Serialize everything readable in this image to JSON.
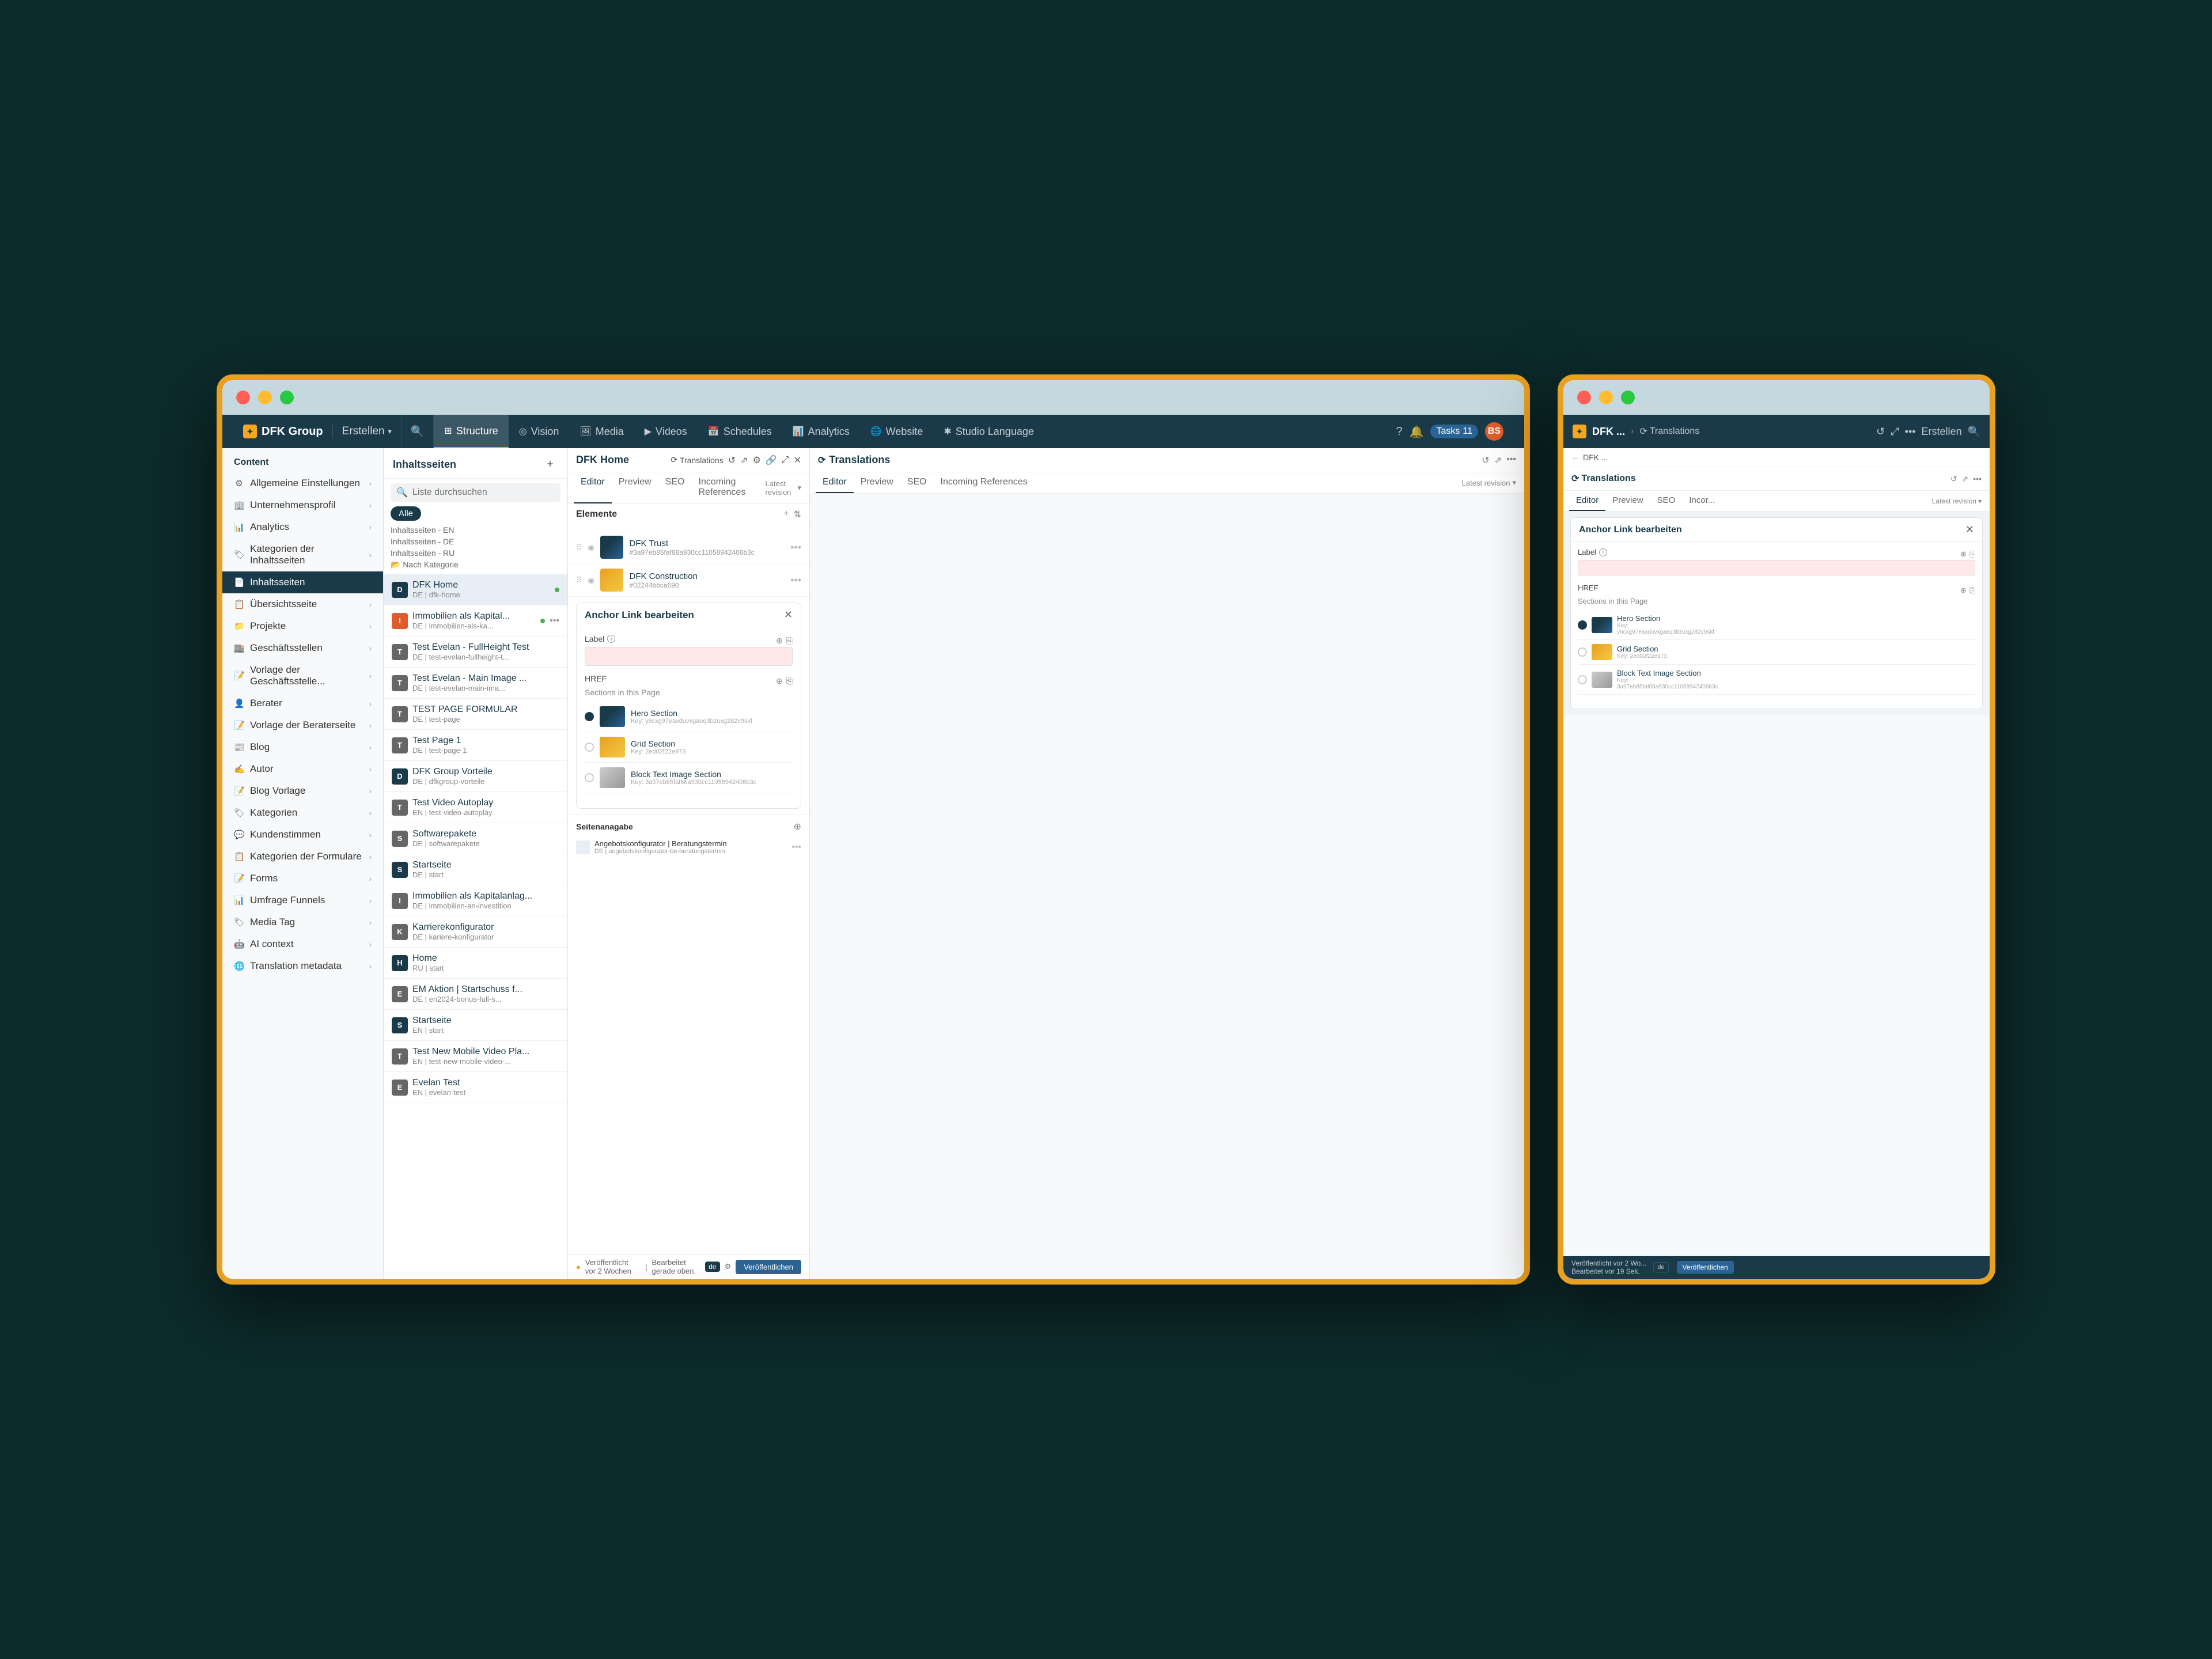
{
  "scene": {
    "background": "#0d2b2b"
  },
  "left_browser": {
    "top_nav": {
      "brand": "DFK Group",
      "brand_icon": "✦",
      "erstellen": "Erstellen",
      "tabs": [
        {
          "label": "Structure",
          "icon": "⊞",
          "active": true
        },
        {
          "label": "Vision",
          "icon": "◎",
          "active": false
        },
        {
          "label": "Media",
          "icon": "🖼",
          "active": false
        },
        {
          "label": "Videos",
          "icon": "▶",
          "active": false
        },
        {
          "label": "Schedules",
          "icon": "📅",
          "active": false
        },
        {
          "label": "Analytics",
          "icon": "📊",
          "active": false
        },
        {
          "label": "Website",
          "icon": "🌐",
          "active": false
        },
        {
          "label": "Studio Language",
          "icon": "✱",
          "active": false
        }
      ],
      "tasks_label": "Tasks",
      "tasks_count": "11",
      "user_initials": "BS"
    },
    "sidebar": {
      "section_title": "Content",
      "items": [
        {
          "label": "Allgemeine Einstellungen",
          "icon": "⚙",
          "active": false
        },
        {
          "label": "Unternehmensprofil",
          "icon": "🏢",
          "active": false
        },
        {
          "label": "Analytics",
          "icon": "📊",
          "active": false
        },
        {
          "label": "Kategorien der Inhaltsseiten",
          "icon": "🏷",
          "active": false
        },
        {
          "label": "Inhaltsseiten",
          "icon": "📄",
          "active": true
        },
        {
          "label": "Übersichtsseite",
          "icon": "📋",
          "active": false
        },
        {
          "label": "Projekte",
          "icon": "📁",
          "active": false
        },
        {
          "label": "Geschäftsstellen",
          "icon": "🏬",
          "active": false
        },
        {
          "label": "Vorlage der Geschäftsstelle...",
          "icon": "📝",
          "active": false
        },
        {
          "label": "Berater",
          "icon": "👤",
          "active": false
        },
        {
          "label": "Vorlage der Beraterseite",
          "icon": "📝",
          "active": false
        },
        {
          "label": "Blog",
          "icon": "📰",
          "active": false
        },
        {
          "label": "Autor",
          "icon": "✍",
          "active": false
        },
        {
          "label": "Blog Vorlage",
          "icon": "📝",
          "active": false
        },
        {
          "label": "Kategorien",
          "icon": "🏷",
          "active": false
        },
        {
          "label": "Kundenstimmen",
          "icon": "💬",
          "active": false
        },
        {
          "label": "Kategorien der Formulare",
          "icon": "📋",
          "active": false
        },
        {
          "label": "Forms",
          "icon": "📝",
          "active": false
        },
        {
          "label": "Umfrage Funnels",
          "icon": "📊",
          "active": false
        },
        {
          "label": "Media Tag",
          "icon": "🏷",
          "active": false
        },
        {
          "label": "AI context",
          "icon": "🤖",
          "active": false
        },
        {
          "label": "Translation metadata",
          "icon": "🌐",
          "active": false
        }
      ]
    },
    "pages_panel": {
      "title": "Inhaltsseiten",
      "search_placeholder": "Liste durchsuchen",
      "filter_tabs": [
        {
          "label": "Alle",
          "active": true
        },
        {
          "label": "Inhaltsseiten - EN",
          "active": false
        },
        {
          "label": "Inhaltsseiten - DE",
          "active": false
        },
        {
          "label": "Inhaltsseiten - RU",
          "active": false
        },
        {
          "label": "Nach Kategorie",
          "active": false
        }
      ],
      "pages": [
        {
          "name": "Immobilien als Kapital...",
          "sub": "DE | immobilien-als-ka...",
          "dot": "green",
          "selected": false
        },
        {
          "name": "Test Evelan - FullHeight Test",
          "sub": "DE | test-evelan-fullheight-t...",
          "dot": "none",
          "selected": false
        },
        {
          "name": "Test Evelan - Main Image ...",
          "sub": "DE | test-evelan-main-ima...",
          "dot": "none",
          "selected": false
        },
        {
          "name": "TEST PAGE FORMULAR",
          "sub": "DE | test-page",
          "dot": "none",
          "selected": false
        },
        {
          "name": "Test Page 1",
          "sub": "DE | test-page-1",
          "dot": "none",
          "selected": false
        },
        {
          "name": "DFK Group Vorteile",
          "sub": "DE | dfkgroup-vorteile",
          "dot": "none",
          "selected": false
        },
        {
          "name": "Test Video Autoplay",
          "sub": "EN | test-video-autoplay",
          "dot": "none",
          "selected": false
        },
        {
          "name": "Softwarepakete",
          "sub": "DE | softwarepakete",
          "dot": "none",
          "selected": false
        },
        {
          "name": "Startseite",
          "sub": "DE | start",
          "dot": "none",
          "selected": false
        },
        {
          "name": "Immobilien als Kapitalanlag...",
          "sub": "DE | immobilien-an-investition",
          "dot": "none",
          "selected": false
        },
        {
          "name": "Karrierekonfigurator",
          "sub": "DE | kariere-konfigurator",
          "dot": "none",
          "selected": false
        },
        {
          "name": "Home",
          "sub": "RU | start",
          "dot": "none",
          "selected": false
        },
        {
          "name": "EM Aktion | Startschuss f...",
          "sub": "DE | en2024-bonus-full-s...",
          "dot": "none",
          "selected": false
        },
        {
          "name": "Startseite",
          "sub": "EN | start",
          "dot": "none",
          "selected": false
        },
        {
          "name": "Test New Mobile Video Pla...",
          "sub": "EN | test-new-mobile-video-...",
          "dot": "none",
          "selected": false
        },
        {
          "name": "Evelan Test",
          "sub": "EN | evelan-test",
          "dot": "none",
          "selected": false
        }
      ],
      "selected_page": "DFK Home",
      "selected_sub": "DE | dfk-home"
    },
    "editor_panel": {
      "title": "DFK Home",
      "tabs": [
        "Editor",
        "Preview",
        "SEO",
        "Incoming References"
      ],
      "active_tab": "Editor",
      "revision_label": "Latest revision",
      "elements_title": "Elemente",
      "elements": [
        {
          "name": "DFK Trust",
          "key": "#3a97eb85faf68a930cc11058942406b3c",
          "type": "trust"
        },
        {
          "name": "DFK Construction",
          "key": "#02244bbca690",
          "type": "construction"
        }
      ],
      "translations_label": "Translations",
      "anchor_dialog": {
        "title": "Anchor Link bearbeiten",
        "label_field": "Label",
        "label_info": true,
        "label_value": "",
        "href_label": "HREF",
        "sections_title": "Sections in this Page",
        "sections": [
          {
            "name": "Hero Section",
            "key": "Key: y6cxg97eaxduvxgaeq3bzuxg282v9skf",
            "selected": true,
            "type": "hero"
          },
          {
            "name": "Grid Section",
            "key": "Key: 2ed02f22e973",
            "selected": false,
            "type": "grid"
          },
          {
            "name": "Block Text Image Section",
            "key": "Key: 3a97eb85faf68a930cc11058942406b3c",
            "selected": false,
            "type": "block"
          }
        ]
      },
      "seitanagabe": {
        "title": "Seitenanagabe",
        "items": [
          {
            "name": "Angebotskonfigurator | Beratungstermin",
            "sub": "DE | angebotskonfigurator-be-beratungstermin"
          }
        ]
      }
    },
    "translations_panel": {
      "title": "Translations",
      "tabs": [
        "Editor",
        "Preview",
        "SEO",
        "Incoming References"
      ],
      "active_tab": "Editor",
      "revision_label": "Latest revision"
    },
    "status_bar": {
      "published_text": "Veröffentlicht vor 2 Wochen",
      "status_text": "Bearbeitet gerade oben.",
      "lang": "de",
      "publish_btn": "Veröffentlichen"
    }
  },
  "right_browser": {
    "top_nav": {
      "brand": "DFK ...",
      "brand_icon": "✦",
      "translations_label": "Translations",
      "erstellen": "Erstellen"
    },
    "breadcrumb": "DFK ...",
    "editor_panel": {
      "title": "Anchor Link bearbeiten",
      "tabs": [
        "Editor",
        "Preview",
        "SEO",
        "Incor..."
      ],
      "active_tab": "Editor",
      "revision_label": "Latest revision",
      "label_field": "Label",
      "label_value": "",
      "href_label": "HREF",
      "sections_title": "Sections in this Page",
      "sections": [
        {
          "name": "Hero Section",
          "key": "Key:\ny6cxg97eaxduvxgaeq3bzuxg282v9skf",
          "selected": true,
          "type": "hero"
        },
        {
          "name": "Grid Section",
          "key": "Key: 2ed02f22e973",
          "selected": false,
          "type": "grid"
        },
        {
          "name": "Block Text Image Section",
          "key": "Key:\n3a97eb85faf68a930cc11058942406b3c",
          "selected": false,
          "type": "block"
        }
      ]
    },
    "status_bar": {
      "text": "Veröffentlicht vor 2 Wo...",
      "sub": "Bearbeitet vor 19 Sek.",
      "lang": "de",
      "publish_btn": "Veröffentlichen"
    }
  }
}
